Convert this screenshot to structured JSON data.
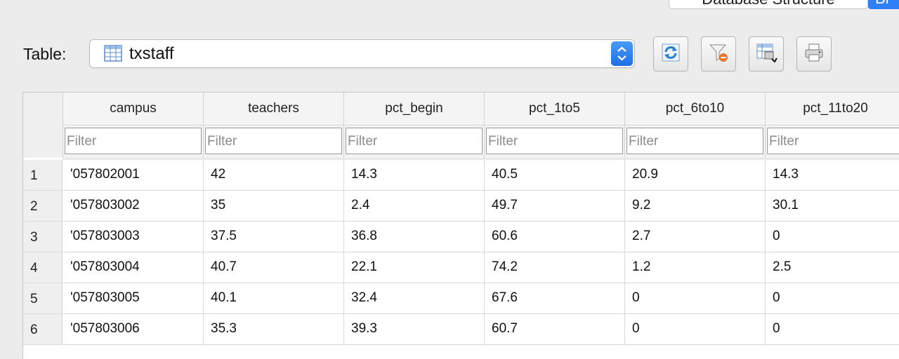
{
  "tabs": {
    "database_structure": "Database Structure",
    "next": "Br"
  },
  "toolbar": {
    "table_label": "Table:",
    "selected_table": "txstaff",
    "buttons": [
      "refresh-icon",
      "clear-filter-icon",
      "save-table-icon",
      "print-icon"
    ]
  },
  "grid": {
    "filter_placeholder": "Filter",
    "columns": [
      "campus",
      "teachers",
      "pct_begin",
      "pct_1to5",
      "pct_6to10",
      "pct_11to20"
    ],
    "rows": [
      {
        "num": "1",
        "cells": [
          "'057802001",
          "42",
          "14.3",
          "40.5",
          "20.9",
          "14.3"
        ]
      },
      {
        "num": "2",
        "cells": [
          "'057803002",
          "35",
          "2.4",
          "49.7",
          "9.2",
          "30.1"
        ]
      },
      {
        "num": "3",
        "cells": [
          "'057803003",
          "37.5",
          "36.8",
          "60.6",
          "2.7",
          "0"
        ]
      },
      {
        "num": "4",
        "cells": [
          "'057803004",
          "40.7",
          "22.1",
          "74.2",
          "1.2",
          "2.5"
        ]
      },
      {
        "num": "5",
        "cells": [
          "'057803005",
          "40.1",
          "32.4",
          "67.6",
          "0",
          "0"
        ]
      },
      {
        "num": "6",
        "cells": [
          "'057803006",
          "35.3",
          "39.3",
          "60.7",
          "0",
          "0"
        ]
      }
    ]
  },
  "colors": {
    "accent": "#2f7ff7",
    "header_bg": "#f4f4f4",
    "window_bg": "#ececec"
  }
}
